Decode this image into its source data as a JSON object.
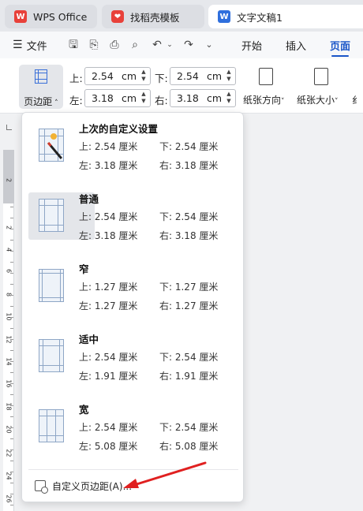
{
  "tabs": [
    {
      "label": "WPS Office"
    },
    {
      "label": "找稻壳模板"
    },
    {
      "label": "文字文稿1"
    }
  ],
  "menu": {
    "file": "文件",
    "items": [
      "开始",
      "插入",
      "页面"
    ]
  },
  "ribbon": {
    "margins_button": "页边距",
    "top_label": "上:",
    "top_value": "2.54",
    "bottom_label": "下:",
    "bottom_value": "2.54",
    "left_label": "左:",
    "left_value": "3.18",
    "right_label": "右:",
    "right_value": "3.18",
    "unit": "cm",
    "orientation": "纸张方向",
    "size": "纸张大小"
  },
  "ruler_numbers": [
    "2",
    "2",
    "4",
    "6",
    "8",
    "10",
    "12",
    "14",
    "16",
    "18",
    "20",
    "22",
    "24",
    "26"
  ],
  "presets": [
    {
      "title": "上次的自定义设置",
      "top": "上: 2.54 厘米",
      "bottom": "下: 2.54 厘米",
      "left": "左: 3.18 厘米",
      "right": "右: 3.18 厘米"
    },
    {
      "title": "普通",
      "top": "上: 2.54 厘米",
      "bottom": "下: 2.54 厘米",
      "left": "左: 3.18 厘米",
      "right": "右: 3.18 厘米"
    },
    {
      "title": "窄",
      "top": "上: 1.27 厘米",
      "bottom": "下: 1.27 厘米",
      "left": "左: 1.27 厘米",
      "right": "右: 1.27 厘米"
    },
    {
      "title": "适中",
      "top": "上: 2.54 厘米",
      "bottom": "下: 2.54 厘米",
      "left": "左: 1.91 厘米",
      "right": "右: 1.91 厘米"
    },
    {
      "title": "宽",
      "top": "上: 2.54 厘米",
      "bottom": "下: 2.54 厘米",
      "left": "左: 5.08 厘米",
      "right": "右: 5.08 厘米"
    }
  ],
  "custom_margins": "自定义页边距(A)...",
  "colors": {
    "accent": "#1a56c8",
    "wps_red": "#e8413a",
    "arrow": "#e02020"
  }
}
